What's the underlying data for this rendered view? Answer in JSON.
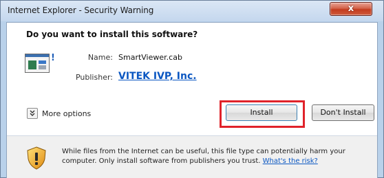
{
  "window": {
    "title": "Internet Explorer - Security Warning",
    "close_label": "x"
  },
  "dialog": {
    "heading": "Do you want to install this software?",
    "name_label": "Name:",
    "name_value": "SmartViewer.cab",
    "publisher_label": "Publisher:",
    "publisher_value": "VITEK IVP, Inc.",
    "more_options_label": "More options",
    "install_label": "Install",
    "dont_install_label": "Don't Install"
  },
  "footer": {
    "warning_text": "While files from the Internet can be useful, this file type can potentially harm your computer. Only install software from publishers you trust.",
    "risk_link": "What's the risk?"
  },
  "colors": {
    "highlight": "#e0222a",
    "link": "#0b57c2",
    "window_frame": "#b9d1ea"
  },
  "icons": [
    "app-icon",
    "chevron-down-icon",
    "shield-icon",
    "close-icon"
  ]
}
